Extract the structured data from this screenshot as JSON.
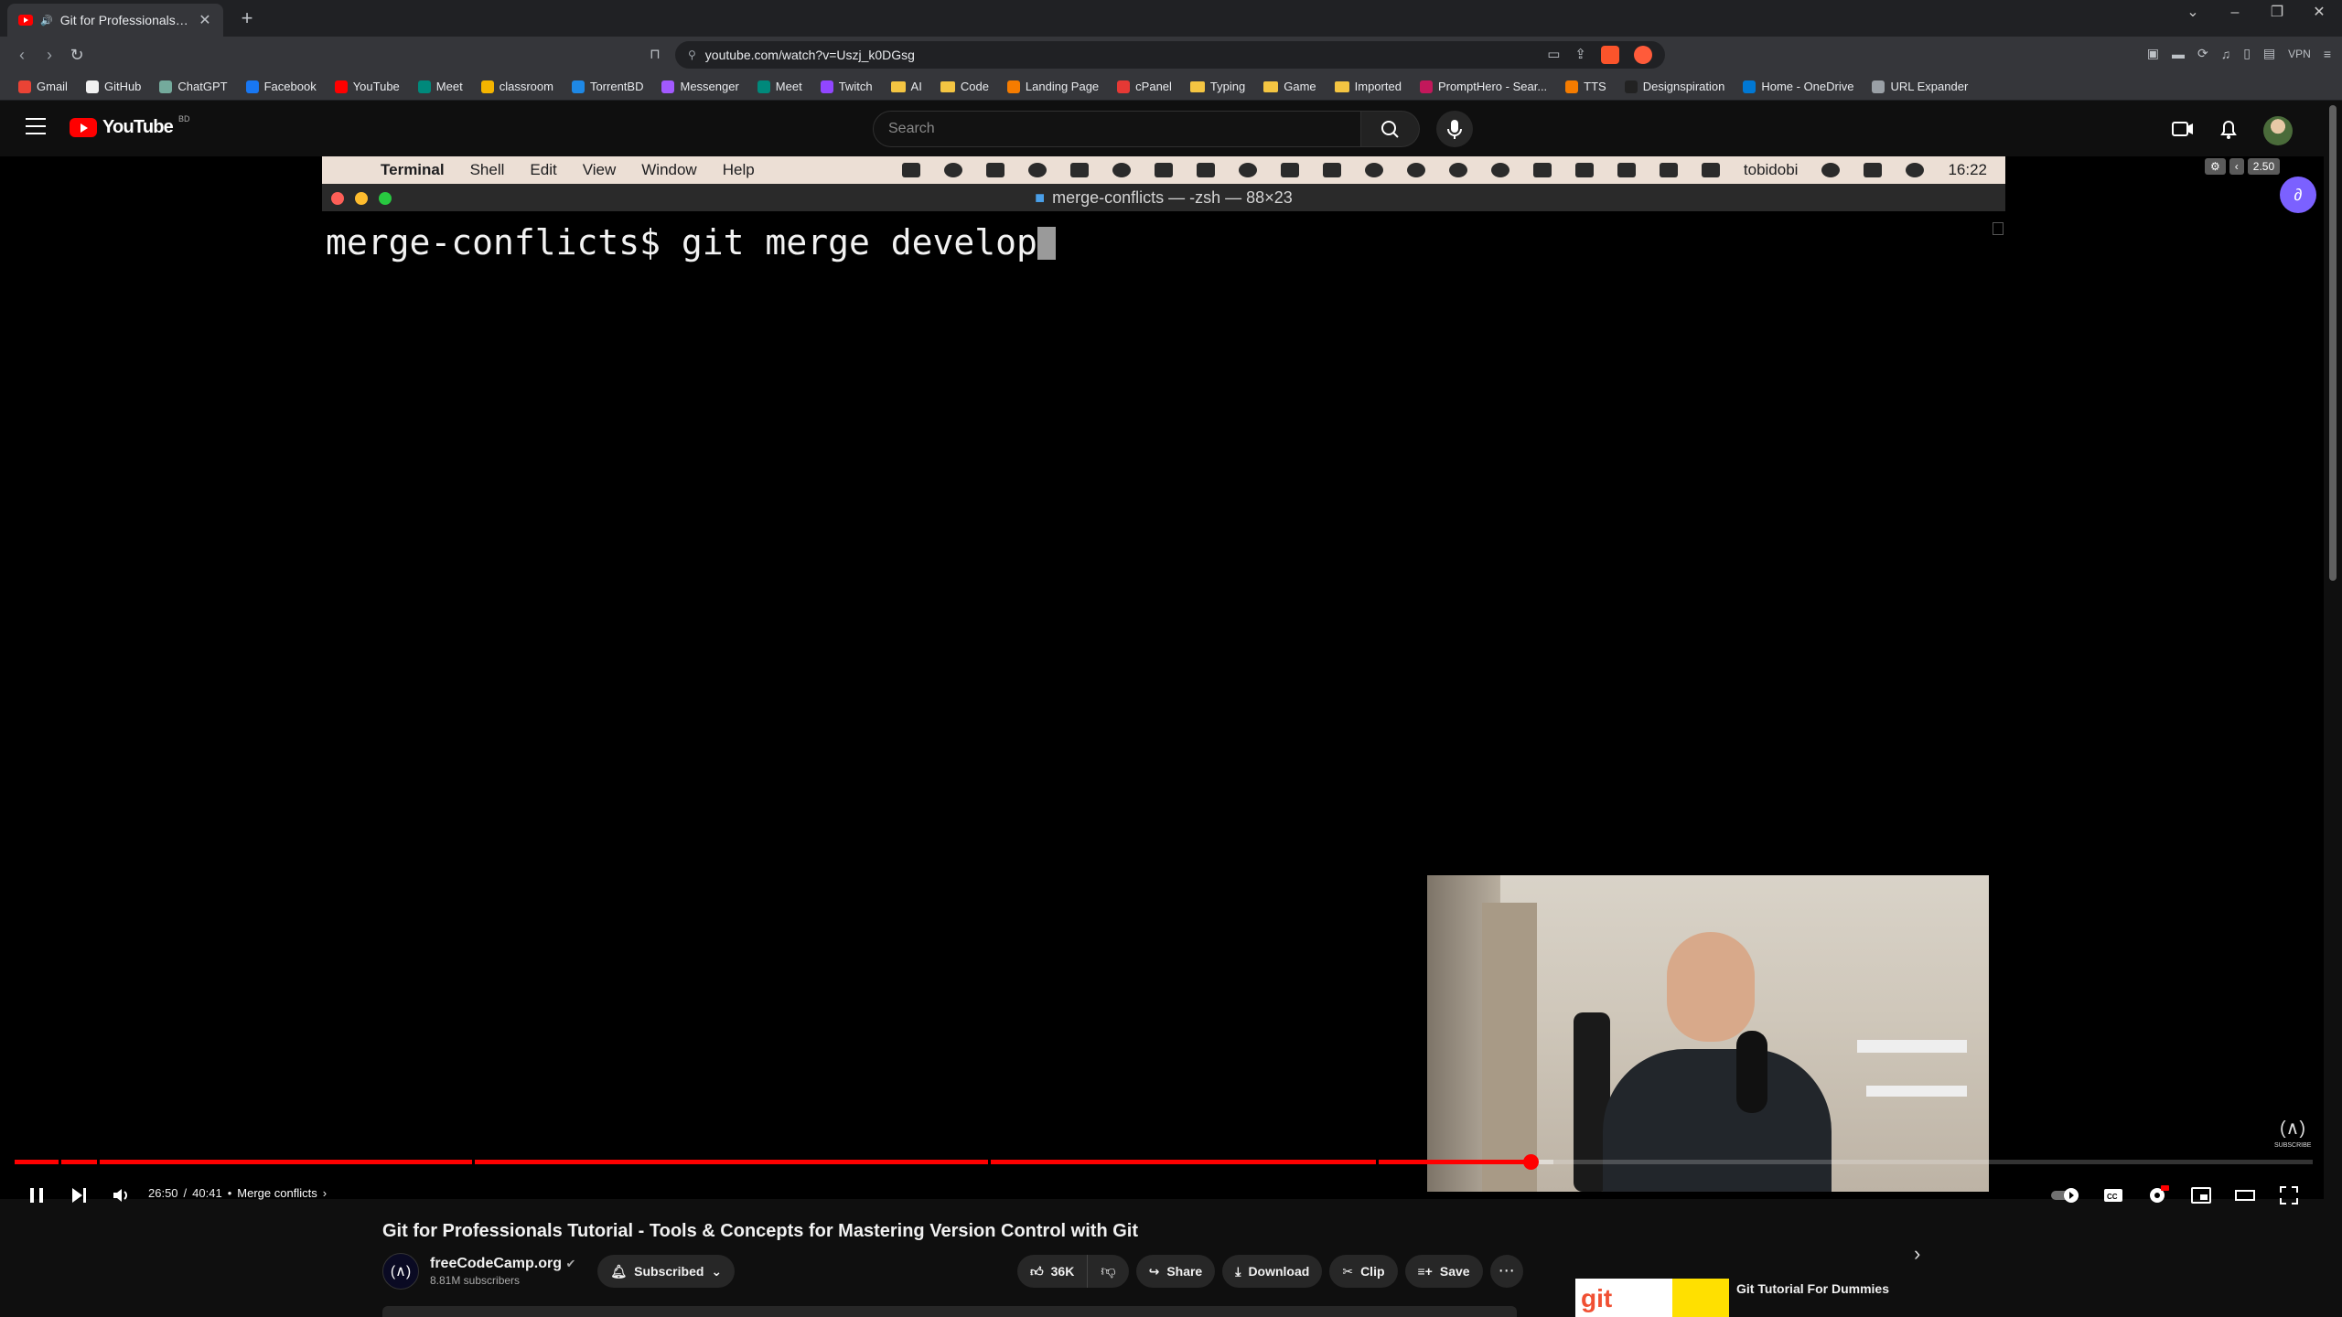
{
  "browser": {
    "tab_title": "Git for Professionals Tutorial",
    "url": "youtube.com/watch?v=Uszj_k0DGsg",
    "vpn_label": "VPN",
    "bookmarks": [
      "Gmail",
      "GitHub",
      "ChatGPT",
      "Facebook",
      "YouTube",
      "Meet",
      "classroom",
      "TorrentBD",
      "Messenger",
      "Meet",
      "Twitch",
      "AI",
      "Code",
      "Landing Page",
      "cPanel",
      "Typing",
      "Game",
      "Imported",
      "PromptHero - Sear...",
      "TTS",
      "Designspiration",
      "Home - OneDrive",
      "URL Expander"
    ]
  },
  "youtube": {
    "logo_text": "YouTube",
    "country_code": "BD",
    "search_placeholder": "Search"
  },
  "mac": {
    "app_name": "Terminal",
    "menu": [
      "Shell",
      "Edit",
      "View",
      "Window",
      "Help"
    ],
    "username": "tobidobi",
    "clock": "16:22",
    "window_title": "merge-conflicts — -zsh — 88×23",
    "overlay_value": "2.50",
    "prompt_line": "merge-conflicts$ git merge develop"
  },
  "player": {
    "current_time": "26:50",
    "duration": "40:41",
    "chapter": "Merge conflicts",
    "progress_fraction": 0.6595,
    "watermark_small": "SUBSCRIBE"
  },
  "video": {
    "title": "Git for Professionals Tutorial - Tools & Concepts for Mastering Version Control with Git",
    "channel_name": "freeCodeCamp.org",
    "subscribers": "8.81M subscribers",
    "subscribed_label": "Subscribed",
    "like_count": "36K",
    "share_label": "Share",
    "download_label": "Download",
    "clip_label": "Clip",
    "save_label": "Save"
  },
  "recommended": {
    "title": "Git Tutorial For Dummies",
    "thumb_text": "git"
  },
  "colors": {
    "youtube_red": "#ff0000",
    "page_bg": "#0f0f0f",
    "mac_menubar": "#ecdfd5"
  }
}
